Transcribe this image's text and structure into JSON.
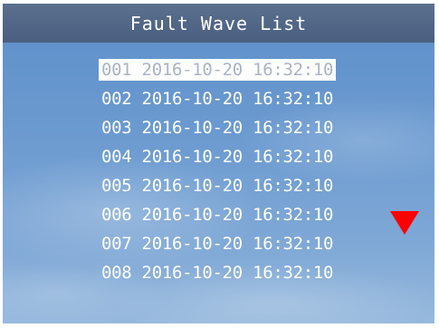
{
  "header": {
    "title": "Fault Wave List"
  },
  "list": {
    "selected_index": 0,
    "items": [
      {
        "label": "001 2016-10-20 16:32:10"
      },
      {
        "label": "002 2016-10-20 16:32:10"
      },
      {
        "label": "003 2016-10-20 16:32:10"
      },
      {
        "label": "004 2016-10-20 16:32:10"
      },
      {
        "label": "005 2016-10-20 16:32:10"
      },
      {
        "label": "006 2016-10-20 16:32:10"
      },
      {
        "label": "007 2016-10-20 16:32:10"
      },
      {
        "label": "008 2016-10-20 16:32:10"
      }
    ]
  },
  "scroll_indicator": {
    "icon": "triangle-down-icon",
    "color": "#ff0000"
  },
  "colors": {
    "title_bar": "#4f6384",
    "background": "#6b9ad0",
    "text": "#ffffff",
    "selected_background": "#ffffff",
    "selected_text": "#a9b4c4"
  }
}
